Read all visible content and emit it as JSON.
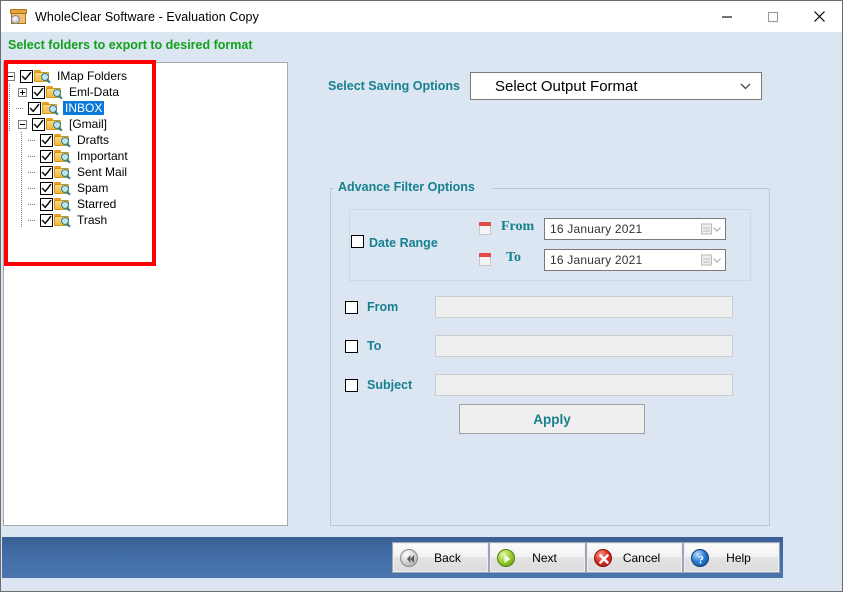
{
  "window": {
    "title": "WholeClear Software - Evaluation Copy",
    "app_icon": "archive-box-icon",
    "controls": {
      "minimize": "minimize-icon",
      "maximize": "maximize-icon",
      "close": "close-icon"
    }
  },
  "subheader": {
    "text": "Select folders to export to desired format",
    "color": "#11a11b"
  },
  "tree": {
    "nodes": [
      {
        "label": "IMap Folders",
        "depth": 0,
        "expander": "minus",
        "checked": true,
        "selected": false
      },
      {
        "label": "Eml-Data",
        "depth": 1,
        "expander": "plus",
        "checked": true,
        "selected": false
      },
      {
        "label": "INBOX",
        "depth": 1,
        "expander": "none",
        "checked": true,
        "selected": true
      },
      {
        "label": "[Gmail]",
        "depth": 1,
        "expander": "minus",
        "checked": true,
        "selected": false
      },
      {
        "label": "Drafts",
        "depth": 2,
        "expander": "none",
        "checked": true,
        "selected": false
      },
      {
        "label": "Important",
        "depth": 2,
        "expander": "none",
        "checked": true,
        "selected": false
      },
      {
        "label": "Sent Mail",
        "depth": 2,
        "expander": "none",
        "checked": true,
        "selected": false
      },
      {
        "label": "Spam",
        "depth": 2,
        "expander": "none",
        "checked": true,
        "selected": false
      },
      {
        "label": "Starred",
        "depth": 2,
        "expander": "none",
        "checked": true,
        "selected": false
      },
      {
        "label": "Trash",
        "depth": 2,
        "expander": "none",
        "checked": true,
        "selected": false
      }
    ]
  },
  "annotation": {
    "shape": "rectangle-highlight",
    "color": "#ff0000"
  },
  "saving": {
    "label": "Select Saving Options",
    "label_color": "#17808f",
    "format_value": "Select Output Format",
    "format_arrow": "chevron-down-icon"
  },
  "filter": {
    "title": "Advance Filter Options",
    "date_range": {
      "label": "Date Range",
      "checked": false,
      "from_caption": "From",
      "to_caption": "To",
      "from_value": "16   January   2021",
      "to_value": "16   January   2021",
      "calendar_icon": "calendar-icon",
      "dropdown_icon": "calendar-dropdown-icon"
    },
    "rows": [
      {
        "label": "From",
        "checked": false,
        "value": ""
      },
      {
        "label": "To",
        "checked": false,
        "value": ""
      },
      {
        "label": "Subject",
        "checked": false,
        "value": ""
      }
    ],
    "apply_label": "Apply"
  },
  "footer": {
    "buttons": [
      {
        "label": "Back",
        "icon": "back-arrow-icon"
      },
      {
        "label": "Next",
        "icon": "next-arrow-icon"
      },
      {
        "label": "Cancel",
        "icon": "cancel-x-icon"
      },
      {
        "label": "Help",
        "icon": "help-question-icon"
      }
    ],
    "bar_color": "#436da6"
  }
}
